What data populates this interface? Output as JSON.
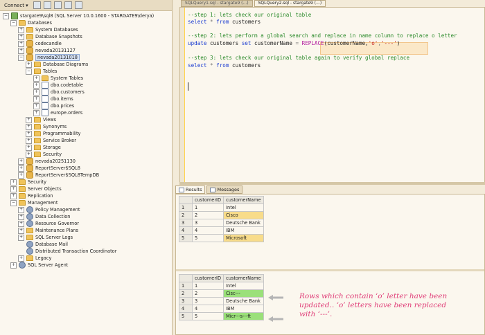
{
  "toolbar": {
    "connect_label": "Connect ▾"
  },
  "tree": [
    {
      "label": "stargate9\\sql8 (SQL Server 10.0.1600 - STARGATE9\\derya)",
      "level": 0,
      "exp": "−",
      "icon": "server"
    },
    {
      "label": "Databases",
      "level": 1,
      "exp": "−",
      "icon": "folder"
    },
    {
      "label": "System Databases",
      "level": 2,
      "exp": "+",
      "icon": "folder"
    },
    {
      "label": "Database Snapshots",
      "level": 2,
      "exp": "+",
      "icon": "folder"
    },
    {
      "label": "codecandle",
      "level": 2,
      "exp": "+",
      "icon": "db"
    },
    {
      "label": "nevada20131127",
      "level": 2,
      "exp": "+",
      "icon": "db"
    },
    {
      "label": "nevada20131018",
      "level": 2,
      "exp": "−",
      "icon": "db",
      "selected": true
    },
    {
      "label": "Database Diagrams",
      "level": 3,
      "exp": "+",
      "icon": "folder"
    },
    {
      "label": "Tables",
      "level": 3,
      "exp": "−",
      "icon": "folder"
    },
    {
      "label": "System Tables",
      "level": 4,
      "exp": "+",
      "icon": "folder"
    },
    {
      "label": "dbo.codetable",
      "level": 4,
      "exp": "+",
      "icon": "table"
    },
    {
      "label": "dbo.customers",
      "level": 4,
      "exp": "+",
      "icon": "table"
    },
    {
      "label": "dbo.items",
      "level": 4,
      "exp": "+",
      "icon": "table"
    },
    {
      "label": "dbo.prices",
      "level": 4,
      "exp": "+",
      "icon": "table"
    },
    {
      "label": "europe.orders",
      "level": 4,
      "exp": "+",
      "icon": "table"
    },
    {
      "label": "Views",
      "level": 3,
      "exp": "+",
      "icon": "folder"
    },
    {
      "label": "Synonyms",
      "level": 3,
      "exp": "+",
      "icon": "folder"
    },
    {
      "label": "Programmability",
      "level": 3,
      "exp": "+",
      "icon": "folder"
    },
    {
      "label": "Service Broker",
      "level": 3,
      "exp": "+",
      "icon": "folder"
    },
    {
      "label": "Storage",
      "level": 3,
      "exp": "+",
      "icon": "folder"
    },
    {
      "label": "Security",
      "level": 3,
      "exp": "+",
      "icon": "folder"
    },
    {
      "label": "nevada20251130",
      "level": 2,
      "exp": "+",
      "icon": "db"
    },
    {
      "label": "ReportServer$SQL8",
      "level": 2,
      "exp": "+",
      "icon": "db"
    },
    {
      "label": "ReportServer$SQL8TempDB",
      "level": 2,
      "exp": "+",
      "icon": "db"
    },
    {
      "label": "Security",
      "level": 1,
      "exp": "+",
      "icon": "folder"
    },
    {
      "label": "Server Objects",
      "level": 1,
      "exp": "+",
      "icon": "folder"
    },
    {
      "label": "Replication",
      "level": 1,
      "exp": "+",
      "icon": "folder"
    },
    {
      "label": "Management",
      "level": 1,
      "exp": "−",
      "icon": "folder"
    },
    {
      "label": "Policy Management",
      "level": 2,
      "exp": "+",
      "icon": "gear"
    },
    {
      "label": "Data Collection",
      "level": 2,
      "exp": "+",
      "icon": "gear"
    },
    {
      "label": "Resource Governor",
      "level": 2,
      "exp": "+",
      "icon": "gear"
    },
    {
      "label": "Maintenance Plans",
      "level": 2,
      "exp": "+",
      "icon": "folder"
    },
    {
      "label": "SQL Server Logs",
      "level": 2,
      "exp": "+",
      "icon": "folder"
    },
    {
      "label": "Database Mail",
      "level": 2,
      "exp": "",
      "icon": "gear"
    },
    {
      "label": "Distributed Transaction Coordinator",
      "level": 2,
      "exp": "",
      "icon": "gear"
    },
    {
      "label": "Legacy",
      "level": 2,
      "exp": "+",
      "icon": "folder"
    },
    {
      "label": "SQL Server Agent",
      "level": 1,
      "exp": "+",
      "icon": "gear"
    }
  ],
  "editor": {
    "line1": "--step 1: lets check our original table",
    "line2_kw1": "select",
    "line2_rest": " * ",
    "line2_kw2": "from",
    "line2_tbl": " customers",
    "line3": "--step 2: lets perform a global search and replace in name column to replace o letter",
    "line4_kw1": "update",
    "line4_a": " customers ",
    "line4_kw2": "set",
    "line4_b": " customerName ",
    "line4_eq": "=",
    "line4_fn": " REPLACE",
    "line4_c": "(customerName,",
    "line4_s1": "'o'",
    "line4_comma": ",",
    "line4_s2": "'---'",
    "line4_end": ")",
    "line5": "--step 3: lets check our original table again to verify global replace",
    "line6_kw1": "select",
    "line6_rest": " * ",
    "line6_kw2": "from",
    "line6_tbl": " customers"
  },
  "result_tabs": {
    "results": "Results",
    "messages": "Messages"
  },
  "grid_headers": {
    "id": "customerID",
    "name": "customerName"
  },
  "grid1": [
    {
      "rn": "1",
      "id": "1",
      "name": "Intel"
    },
    {
      "rn": "2",
      "id": "2",
      "name": "Cisco"
    },
    {
      "rn": "3",
      "id": "3",
      "name": "Deutsche Bank"
    },
    {
      "rn": "4",
      "id": "4",
      "name": "IBM"
    },
    {
      "rn": "5",
      "id": "5",
      "name": "Microsoft"
    }
  ],
  "grid2": [
    {
      "rn": "1",
      "id": "1",
      "name": "Intel"
    },
    {
      "rn": "2",
      "id": "2",
      "name": "Cisc---"
    },
    {
      "rn": "3",
      "id": "3",
      "name": "Deutsche Bank"
    },
    {
      "rn": "4",
      "id": "4",
      "name": "IBM"
    },
    {
      "rn": "5",
      "id": "5",
      "name": "Micr---s---ft"
    }
  ],
  "note": {
    "line1": "Rows which contain ‘o’ letter have been",
    "line2": "updated.. ‘o’ letters have been replaced",
    "line3": "with ‘---’."
  },
  "colors": {
    "highlight_yellow": "#f8dc8a",
    "highlight_green": "#9be07a",
    "note_pink": "#e0407a"
  }
}
